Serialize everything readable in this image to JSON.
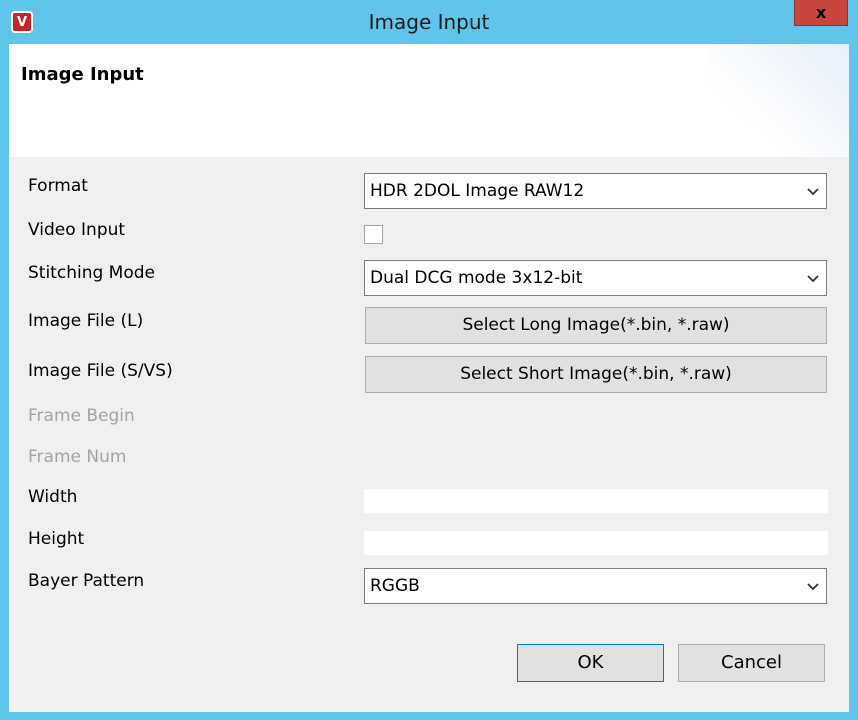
{
  "window": {
    "title": "Image Input",
    "close_label": "x"
  },
  "banner": {
    "title": "Image Input"
  },
  "form": {
    "format": {
      "label": "Format",
      "value": "HDR 2DOL Image RAW12"
    },
    "video_input": {
      "label": "Video Input",
      "checked": false
    },
    "stitching_mode": {
      "label": "Stitching Mode",
      "value": "Dual DCG mode 3x12-bit"
    },
    "image_file_l": {
      "label": "Image File (L)",
      "button_label": "Select Long Image(*.bin, *.raw)"
    },
    "image_file_svs": {
      "label": "Image File (S/VS)",
      "button_label": "Select Short Image(*.bin, *.raw)"
    },
    "frame_begin": {
      "label": "Frame Begin"
    },
    "frame_num": {
      "label": "Frame Num"
    },
    "width": {
      "label": "Width",
      "value": ""
    },
    "height": {
      "label": "Height",
      "value": ""
    },
    "bayer_pattern": {
      "label": "Bayer Pattern",
      "value": "RGGB"
    }
  },
  "buttons": {
    "ok_label": "OK",
    "cancel_label": "Cancel"
  },
  "icons": {
    "app": "app-logo-icon",
    "close": "close-icon",
    "dropdown": "chevron-down-icon"
  },
  "colors": {
    "titlebar": "#60c5ea",
    "close_button": "#c7473f",
    "app_icon": "#c1262b",
    "client_bg": "#f0f0f0",
    "ok_border": "#0078d7"
  }
}
